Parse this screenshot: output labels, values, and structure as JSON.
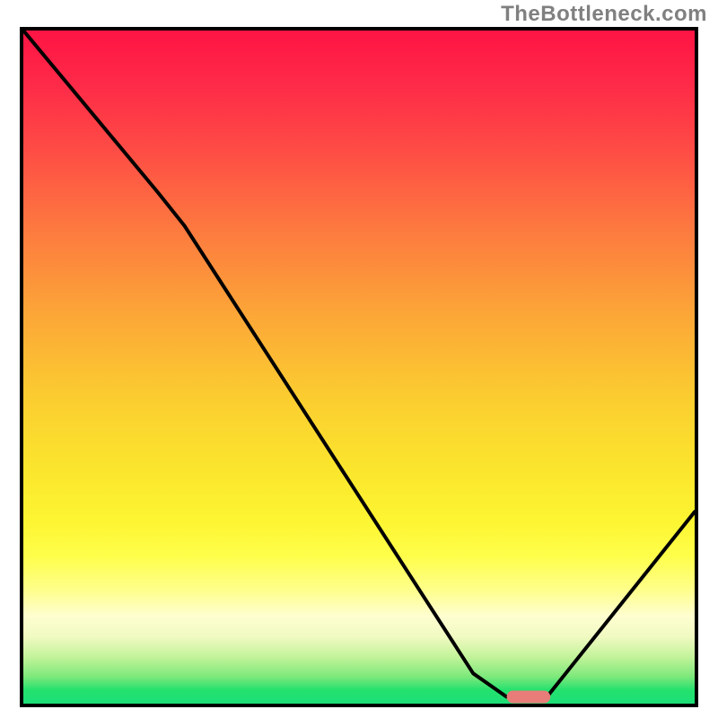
{
  "watermark": "TheBottleneck.com",
  "chart_data": {
    "type": "line",
    "title": "",
    "xlabel": "",
    "ylabel": "",
    "x_range": [
      0,
      100
    ],
    "y_range": [
      0,
      100
    ],
    "grid": false,
    "series": [
      {
        "name": "bottleneck-curve",
        "points": [
          {
            "x": 0.0,
            "y": 100.0
          },
          {
            "x": 20.0,
            "y": 76.0
          },
          {
            "x": 24.0,
            "y": 71.0
          },
          {
            "x": 67.0,
            "y": 4.5
          },
          {
            "x": 72.0,
            "y": 1.0
          },
          {
            "x": 78.0,
            "y": 1.0
          },
          {
            "x": 100.0,
            "y": 28.5
          }
        ],
        "color": "#000000"
      }
    ],
    "marker": {
      "name": "optimal-region",
      "x_start": 72.0,
      "x_end": 78.5,
      "y": 1.0,
      "color": "#e77c78"
    },
    "background": {
      "type": "vertical-gradient-bottleneck",
      "stops": [
        {
          "pos": 0.0,
          "color": "#fe1444"
        },
        {
          "pos": 0.65,
          "color": "#fbe52d"
        },
        {
          "pos": 1.0,
          "color": "#1cdf77"
        }
      ]
    }
  }
}
